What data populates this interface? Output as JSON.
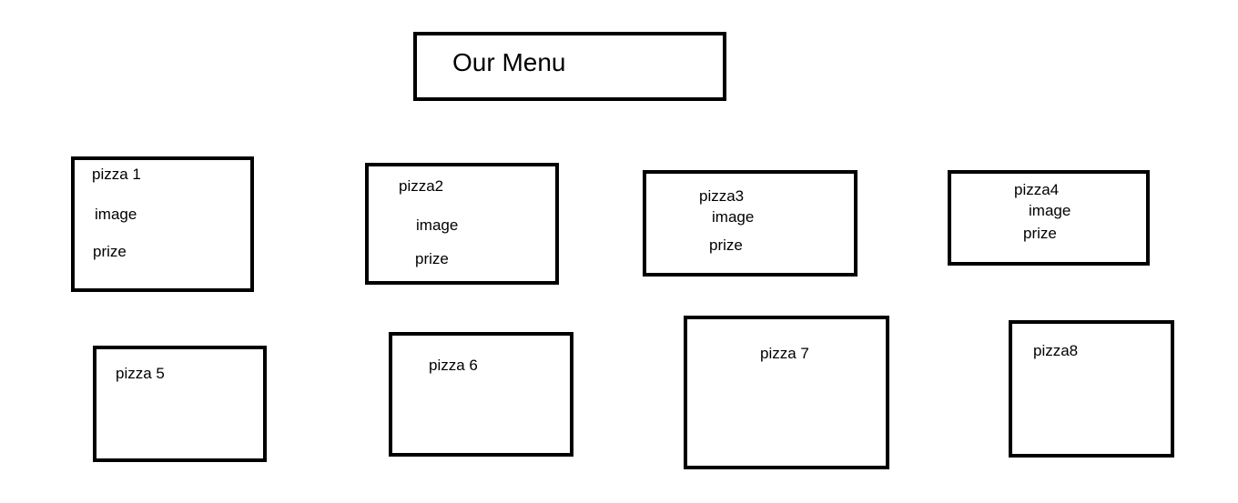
{
  "title": "Our Menu",
  "cards": [
    {
      "name": "pizza 1",
      "image": "image",
      "prize": "prize"
    },
    {
      "name": "pizza2",
      "image": "image",
      "prize": "prize"
    },
    {
      "name": "pizza3",
      "image": "image",
      "prize": "prize"
    },
    {
      "name": "pizza4",
      "image": "image",
      "prize": "prize"
    },
    {
      "name": "pizza 5"
    },
    {
      "name": "pizza 6"
    },
    {
      "name": "pizza 7"
    },
    {
      "name": "pizza8"
    }
  ]
}
